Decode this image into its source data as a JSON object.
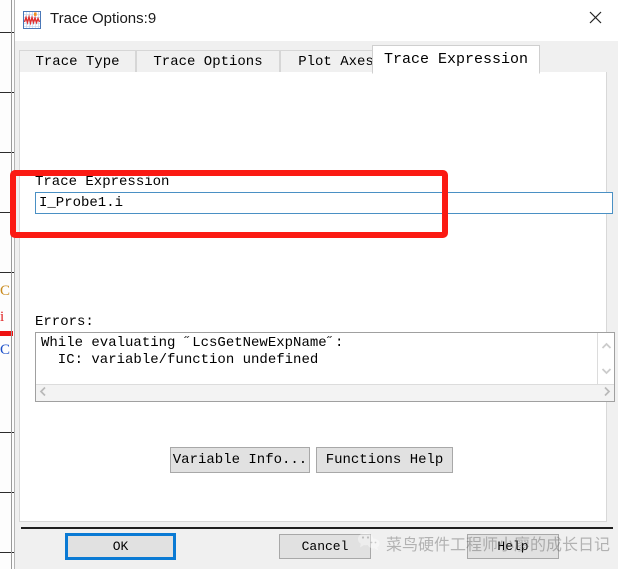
{
  "window": {
    "title": "Trace Options:9",
    "icon": "waveform-graph-icon",
    "close_label": "✕"
  },
  "tabs": [
    {
      "label": "Trace Type",
      "active": false
    },
    {
      "label": "Trace Options",
      "active": false
    },
    {
      "label": "Plot Axes",
      "active": false
    },
    {
      "label": "Trace Expression",
      "active": true
    }
  ],
  "expression": {
    "label": "Trace Expression",
    "value": "I_Probe1.i",
    "placeholder": ""
  },
  "errors": {
    "label": "Errors:",
    "text": "While evaluating ˝LcsGetNewExpName˝:\n  IC: variable/function undefined"
  },
  "mid_buttons": {
    "variable_info": "Variable Info...",
    "functions_help": "Functions Help"
  },
  "bottom_buttons": {
    "ok": "OK",
    "cancel": "Cancel",
    "help": "Help"
  },
  "watermark": {
    "text": "菜鸟硬件工程师小廖的成长日记",
    "logo": "wechat-icon"
  },
  "colors": {
    "accent_blue": "#0a7ad4",
    "annotation_red": "#fb1a13",
    "input_border": "#4a90c4",
    "dialog_bg": "#f0f0f0",
    "panel_bg": "#ffffff"
  }
}
